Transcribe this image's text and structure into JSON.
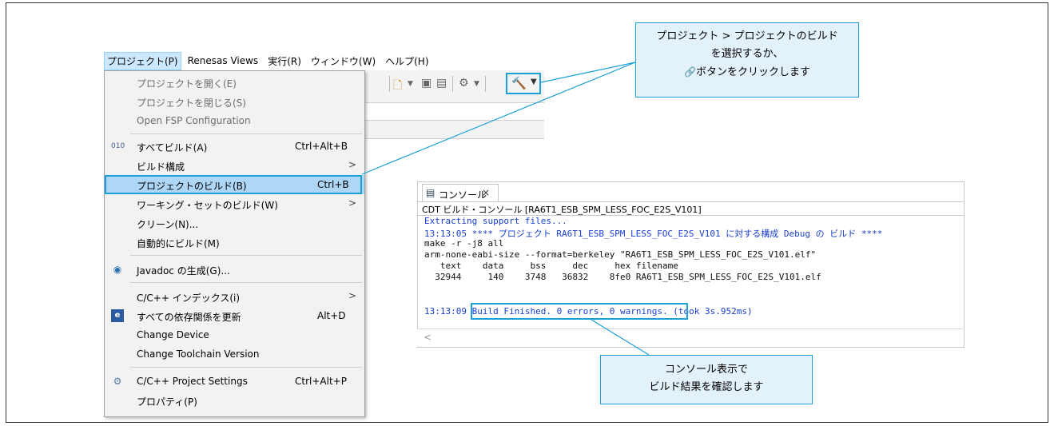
{
  "menubar": {
    "items": [
      "プロジェクト(P)",
      "Renesas Views",
      "実行(R)",
      "ウィンドウ(W)",
      "ヘルプ(H)"
    ],
    "active_index": 0
  },
  "toolbar": {
    "icons": [
      "new-project-icon",
      "save-icon",
      "save-all-icon",
      "debug-icon",
      "hammer-icon",
      "dropdown-icon"
    ]
  },
  "menu": {
    "items": [
      {
        "label": "プロジェクトを開く(E)",
        "shortcut": "",
        "disabled": true
      },
      {
        "label": "プロジェクトを閉じる(S)",
        "shortcut": "",
        "disabled": true
      },
      {
        "label": "Open FSP Configuration",
        "shortcut": "",
        "disabled": true
      },
      {
        "label": "すべてビルド(A)",
        "shortcut": "Ctrl+Alt+B",
        "icon": "build-all-icon"
      },
      {
        "label": "ビルド構成",
        "submenu": true
      },
      {
        "label": "プロジェクトのビルド(B)",
        "shortcut": "Ctrl+B",
        "highlighted": true
      },
      {
        "label": "ワーキング・セットのビルド(W)",
        "submenu": true
      },
      {
        "label": "クリーン(N)..."
      },
      {
        "label": "自動的にビルド(M)"
      },
      {
        "label": "Javadoc の生成(G)...",
        "icon": "javadoc-icon"
      },
      {
        "label": "C/C++ インデックス(i)",
        "submenu": true
      },
      {
        "label": "すべての依存関係を更新",
        "shortcut": "Alt+D",
        "icon": "dependency-icon"
      },
      {
        "label": "Change Device"
      },
      {
        "label": "Change Toolchain Version"
      },
      {
        "label": "C/C++ Project Settings",
        "shortcut": "Ctrl+Alt+P",
        "icon": "settings-icon"
      },
      {
        "label": "プロパティ(P)"
      }
    ],
    "submenu_arrow": ">"
  },
  "console": {
    "tab_label": "コンソール",
    "tab_close": "×",
    "subtitle": "CDT ビルド・コンソール [RA6T1_ESB_SPM_LESS_FOC_E2S_V101]",
    "lines": {
      "l1": "Extracting support files...",
      "l2": "13:13:05 **** プロジェクト RA6T1_ESB_SPM_LESS_FOC_E2S_V101 に対する構成 Debug の ビルド ****",
      "l3": "make -r -j8 all",
      "l4": "arm-none-eabi-size --format=berkeley \"RA6T1_ESB_SPM_LESS_FOC_E2S_V101.elf\"",
      "l5": "   text    data     bss     dec     hex filename",
      "l6": "  32944     140    3748   36832    8fe0 RA6T1_ESB_SPM_LESS_FOC_E2S_V101.elf",
      "l7a": "13:13:09 ",
      "l7b": "Build Finished. 0 errors, 0 warnings.",
      "l7c": " (took 3s.952ms)"
    },
    "scroll_left": "<"
  },
  "callout_top": {
    "line1": "プロジェクト > プロジェクトのビルド",
    "line2": "を選択するか、",
    "line3": "ボタンをクリックします",
    "link_glyph": "🔗"
  },
  "callout_bottom": {
    "line1": "コンソール表示で",
    "line2": "ビルド結果を確認します"
  },
  "colors": {
    "accent": "#1aa0d8",
    "callout_bg": "#e3f1fb",
    "menu_highlight": "#aed6f7",
    "console_blue": "#1a3fd0"
  }
}
